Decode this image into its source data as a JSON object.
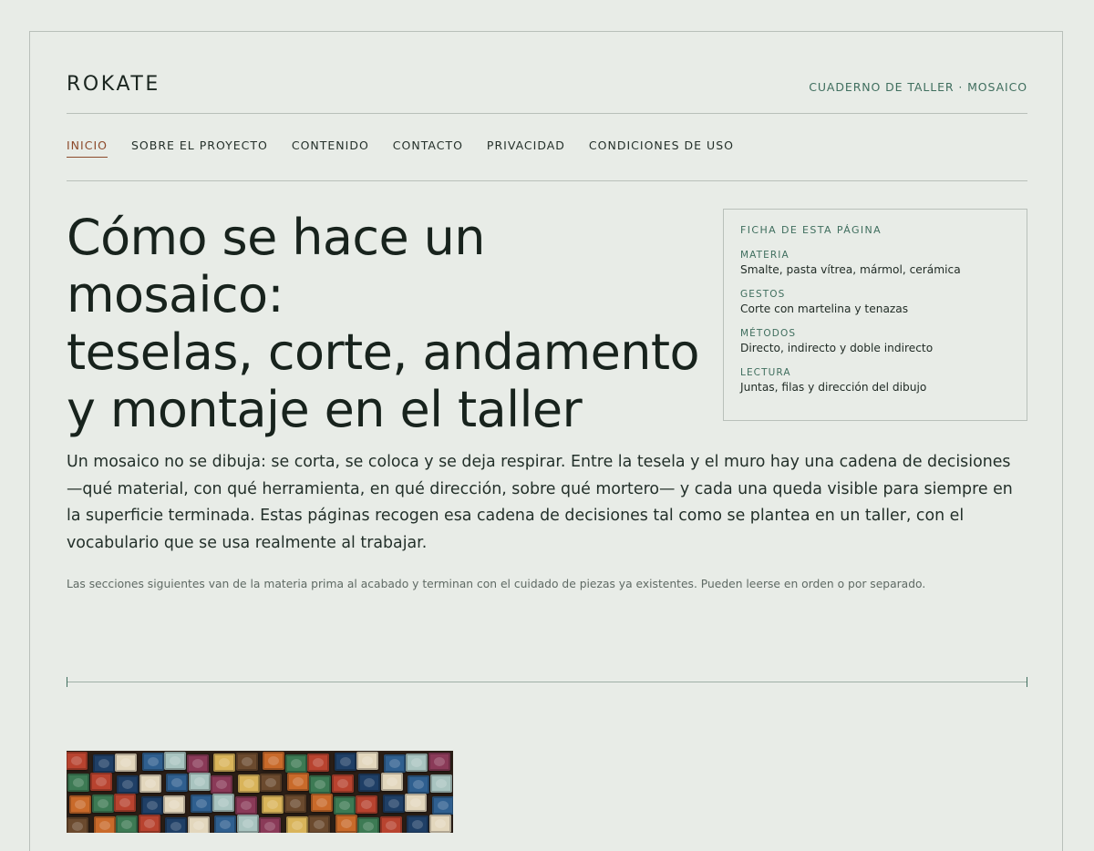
{
  "site": {
    "brand": "ROKATE",
    "tagline": "CUADERNO DE TALLER · MOSAICO"
  },
  "nav": {
    "items": [
      {
        "label": "INICIO",
        "active": true
      },
      {
        "label": "SOBRE EL PROYECTO",
        "active": false
      },
      {
        "label": "CONTENIDO",
        "active": false
      },
      {
        "label": "CONTACTO",
        "active": false
      },
      {
        "label": "PRIVACIDAD",
        "active": false
      },
      {
        "label": "CONDICIONES DE USO",
        "active": false
      }
    ]
  },
  "hero": {
    "title_lines": [
      "Cómo se hace un mosaico:",
      "teselas, corte, andamento",
      "y montaje en el taller"
    ]
  },
  "card": {
    "title": "FICHA DE ESTA PÁGINA",
    "rows": [
      {
        "label": "MATERIA",
        "value": "Smalte, pasta vítrea, mármol, cerámica"
      },
      {
        "label": "GESTOS",
        "value": "Corte con martelina y tenazas"
      },
      {
        "label": "MÉTODOS",
        "value": "Directo, indirecto y doble indirecto"
      },
      {
        "label": "LECTURA",
        "value": "Juntas, filas y dirección del dibujo"
      }
    ]
  },
  "intro": {
    "lead": "Un mosaico no se dibuja: se corta, se coloca y se deja respirar. Entre la tesela y el muro hay una cadena de decisiones —qué material, con qué herramienta, en qué dirección, sobre qué mortero— y cada una queda visible para siempre en la superficie terminada. Estas páginas recogen esa cadena de decisiones tal como se plantea en un taller, con el vocabulario que se usa realmente al trabajar.",
    "note": "Las secciones siguientes van de la materia prima al acabado y terminan con el cuidado de piezas ya existentes. Pueden leerse en orden o por separado."
  },
  "colors": {
    "background": "#e8ece7",
    "accent": "#3f6e5e",
    "active_nav": "#8c4a2b",
    "text": "#1b2620"
  },
  "photo": {
    "tile_colors": [
      "#b8432f",
      "#2f5f8f",
      "#d9b45a",
      "#3d7a54",
      "#e3d7bd",
      "#8a3a58",
      "#c96a2a",
      "#1f3f66",
      "#a9c4c0",
      "#6b4a2e"
    ]
  }
}
